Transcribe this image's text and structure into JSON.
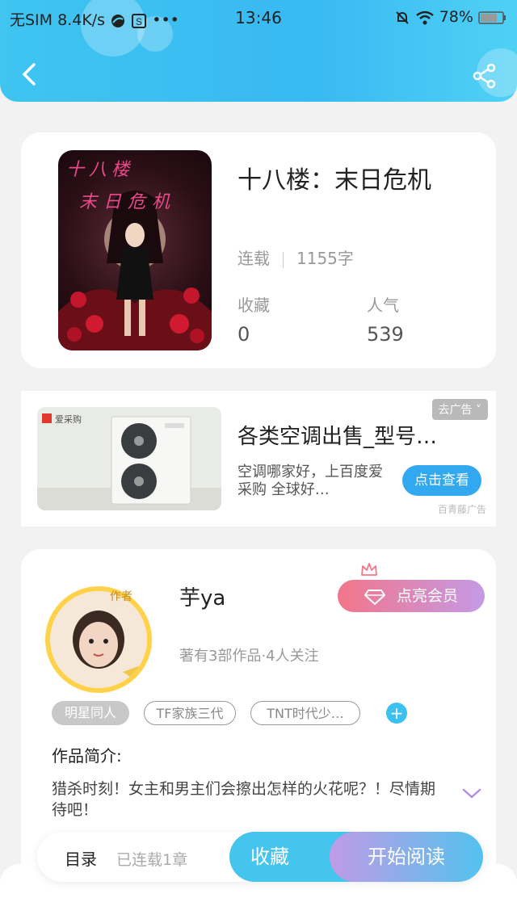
{
  "status_bar": {
    "carrier": "无SIM",
    "speed": "8.4K/s",
    "more": "•••",
    "time": "13:46",
    "battery": "78%"
  },
  "nav": {
    "back_icon": "chevron-left-icon",
    "share_icon": "share-icon"
  },
  "book": {
    "title": "十八楼：末日危机",
    "cover_line1": "十八楼",
    "cover_line2": "末日危机",
    "status": "连载",
    "word_count": "1155字",
    "favorites_label": "收藏",
    "favorites_value": "0",
    "popularity_label": "人气",
    "popularity_value": "539"
  },
  "ad": {
    "brand": "爱采购",
    "title": "各类空调出售_型号…",
    "description": "空调哪家好，上百度爱采购 全球好…",
    "tag": "去广告",
    "button": "点击查看",
    "source": "百青藤广告"
  },
  "author": {
    "name": "芋ya",
    "badge": "作者",
    "subtitle": "著有3部作品·4人关注",
    "vip_button": "点亮会员",
    "tags": [
      "明星同人",
      "TF家族三代",
      "TNT时代少…"
    ],
    "intro_label": "作品简介:",
    "intro_text": "猎杀时刻！女主和男主们会擦出怎样的火花呢？！尽情期待吧！"
  },
  "bottom": {
    "toc": "目录",
    "chapters": "已连载1章",
    "favorite_button": "收藏",
    "read_button": "开始阅读"
  },
  "colors": {
    "accent": "#3cc0f0",
    "vip_start": "#f2768a",
    "vip_end": "#c49ae6"
  }
}
